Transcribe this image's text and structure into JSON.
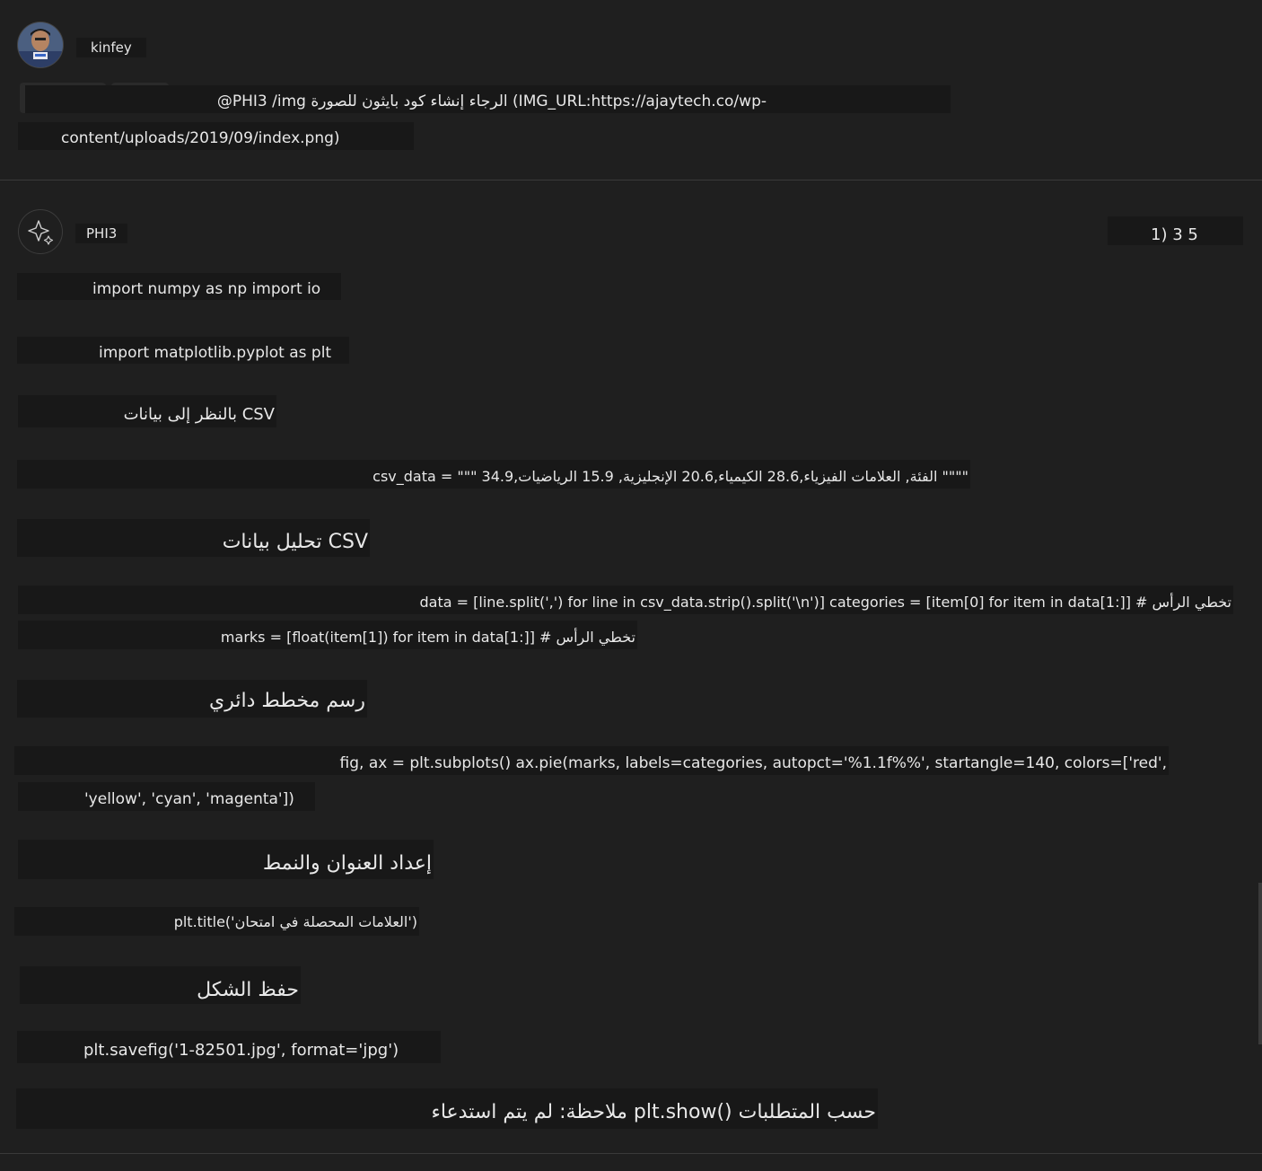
{
  "user": {
    "name": "kinfey",
    "prompt_line1": "@PHI3 /img الرجاء إنشاء كود بايثون للصورة (IMG_URL:https://ajaytech.co/wp-",
    "prompt_line2": "content/uploads/2019/09/index.png)"
  },
  "bot": {
    "name": "PHI3",
    "vote_counter": "1) 3 5",
    "lines": {
      "l1": "import numpy as np import io",
      "l2": "import matplotlib.pyplot as plt",
      "h1": "بالنظر إلى بيانات CSV",
      "l3": "csv_data = \"\"\" 34.9,الفئة, العلامات الفيزياء,28.6 الكيمياء,20.6 الإنجليزية, 15.9 الرياضيات \"\"\"\"",
      "h2": "تحليل بيانات CSV",
      "l4": "data = [line.split(',') for line in csv_data.strip().split('\\n')] categories = [item[0] for item in data[1:]] # تخطي الرأس",
      "l5": "marks = [float(item[1]) for item in data[1:]] # تخطي الرأس",
      "h3": "رسم مخطط دائري",
      "l6": "fig, ax = plt.subplots() ax.pie(marks, labels=categories, autopct='%1.1f%%', startangle=140, colors=['red',",
      "l7": "'yellow', 'cyan', 'magenta'])",
      "h4": "إعداد العنوان والنمط",
      "l8": "plt.title('العلامات المحصلة في امتحان')",
      "h5": "حفظ الشكل",
      "l9": "plt.savefig('1-82501.jpg', format='jpg')",
      "note": "ملاحظة: لم يتم استدعاء plt.show() حسب المتطلبات"
    }
  },
  "icons": {
    "user_avatar": "user-avatar-photo",
    "bot_avatar": "sparkle-icon"
  }
}
